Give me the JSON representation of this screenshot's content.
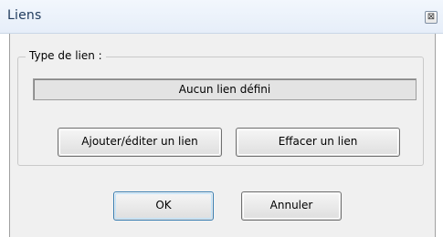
{
  "window": {
    "title": "Liens",
    "close_glyph": "⊠",
    "close_icon": "close-icon"
  },
  "group": {
    "label": "Type de lien :"
  },
  "link_field": {
    "value": "Aucun lien défini"
  },
  "buttons": {
    "add_edit": "Ajouter/éditer un lien",
    "delete": "Effacer un lien",
    "ok": "OK",
    "cancel": "Annuler"
  }
}
